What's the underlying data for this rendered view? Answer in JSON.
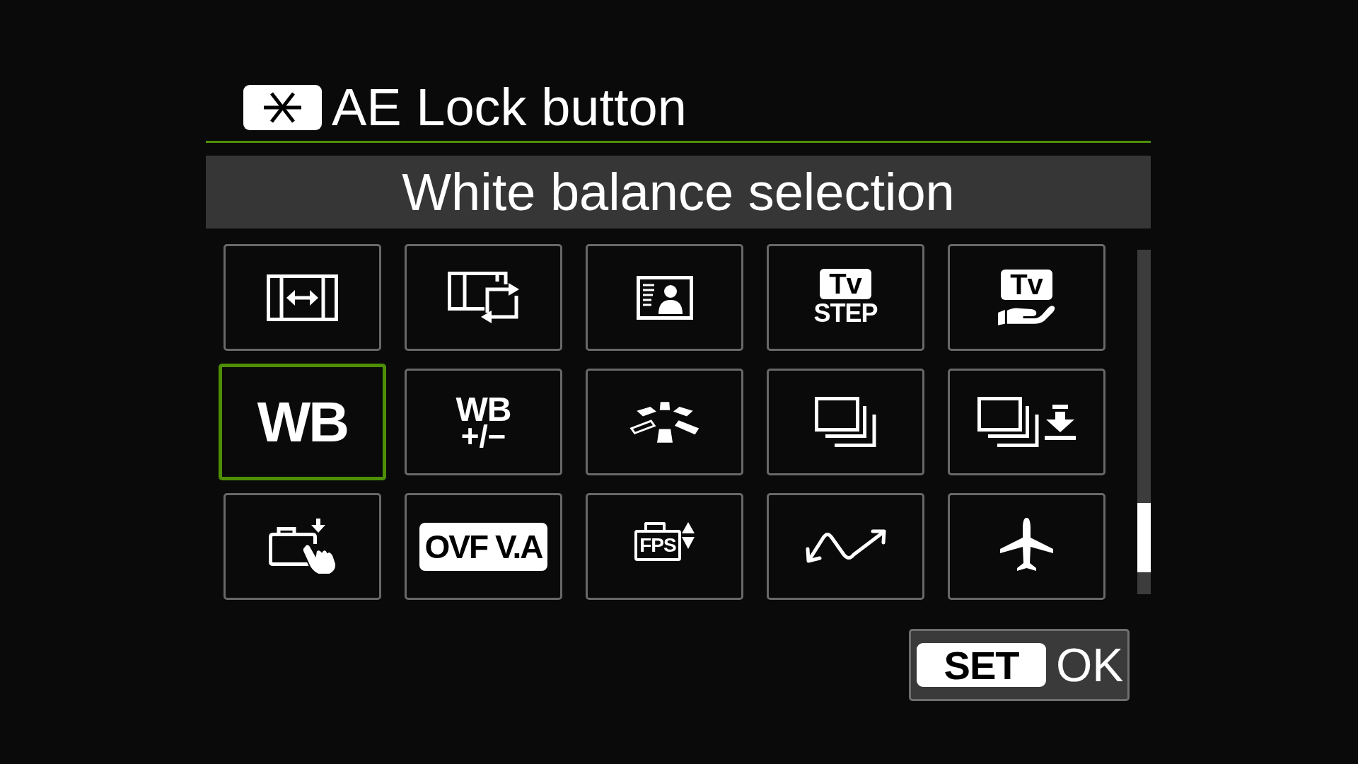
{
  "screen": {
    "title": "AE Lock button",
    "function_name": "White balance selection"
  },
  "options": [
    {
      "kind": "frame",
      "selected": false
    },
    {
      "kind": "cycle",
      "selected": false
    },
    {
      "kind": "card",
      "selected": false
    },
    {
      "kind": "step",
      "label": "Tv",
      "sublabel": "STEP",
      "selected": false
    },
    {
      "kind": "hand",
      "label": "Tv",
      "selected": false
    },
    {
      "kind": "text",
      "label": "WB",
      "selected": true
    },
    {
      "kind": "stacked",
      "label": "WB",
      "sublabel": "+/−",
      "selected": false
    },
    {
      "kind": "zones",
      "selected": false
    },
    {
      "kind": "frames",
      "selected": false
    },
    {
      "kind": "save",
      "selected": false
    },
    {
      "kind": "camera",
      "selected": false
    },
    {
      "kind": "tag",
      "label": "OVF V.A",
      "selected": false
    },
    {
      "kind": "fps",
      "label": "FPS",
      "selected": false
    },
    {
      "kind": "wave",
      "selected": false
    },
    {
      "kind": "plane",
      "selected": false
    }
  ],
  "confirm": {
    "key": "SET",
    "label": "OK"
  }
}
